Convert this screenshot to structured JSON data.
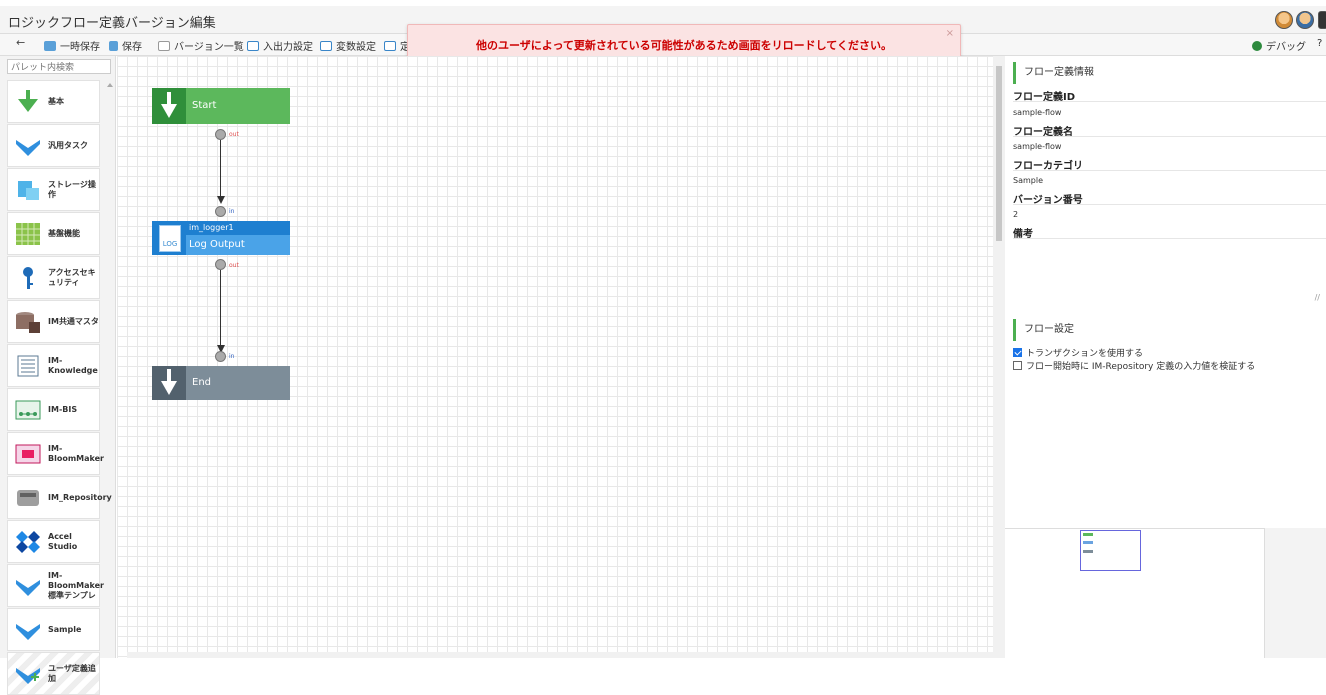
{
  "window": {
    "title": "ロジックフロー定義バージョン編集"
  },
  "toolbar": {
    "temp_save": "一時保存",
    "save": "保存",
    "version_list": "バージョン一覧",
    "io_settings": "入出力設定",
    "var_settings": "変数設定",
    "truncated": "定",
    "debug": "デバッグ",
    "help": "?"
  },
  "alert": {
    "message": "他のユーザによって更新されている可能性があるため画面をリロードしてください。",
    "close": "×"
  },
  "palette": {
    "search_placeholder": "パレット内検索",
    "items": [
      {
        "label": "基本",
        "icon": "green-down-arrow-icon"
      },
      {
        "label": "汎用タスク",
        "icon": "blue-down-arrow-icon"
      },
      {
        "label": "ストレージ操作",
        "icon": "storage-icon"
      },
      {
        "label": "基盤機能",
        "icon": "grid-icon"
      },
      {
        "label": "アクセスセキュリティ",
        "icon": "key-icon"
      },
      {
        "label": "IM共通マスタ",
        "icon": "database-icon"
      },
      {
        "label": "IM-Knowledge",
        "icon": "knowledge-icon"
      },
      {
        "label": "IM-BIS",
        "icon": "bis-icon"
      },
      {
        "label": "IM-BloomMaker",
        "icon": "bloommaker-icon"
      },
      {
        "label": "IM_Repository",
        "icon": "repository-icon"
      },
      {
        "label": "Accel Studio",
        "icon": "accel-studio-icon"
      },
      {
        "label": "IM-BloomMaker 標準テンプレ",
        "icon": "blue-down-arrow-icon"
      },
      {
        "label": "Sample",
        "icon": "blue-down-arrow-icon"
      },
      {
        "label": "ユーザ定義追加",
        "icon": "add-user-defined-icon"
      }
    ]
  },
  "canvas": {
    "start_node": {
      "label": "Start",
      "out_port": "out"
    },
    "log_node": {
      "name": "im_logger1",
      "label": "Log Output",
      "icon_text": "LOG",
      "in_port": "in",
      "out_port": "out"
    },
    "end_node": {
      "label": "End",
      "in_port": "in"
    }
  },
  "properties": {
    "section_title": "フロー定義情報",
    "flow_id_label": "フロー定義ID",
    "flow_id": "sample-flow",
    "flow_name_label": "フロー定義名",
    "flow_name": "sample-flow",
    "category_label": "フローカテゴリ",
    "category": "Sample",
    "version_label": "バージョン番号",
    "version": "2",
    "notes_label": "備考",
    "notes": ""
  },
  "flow_settings": {
    "section_title": "フロー設定",
    "use_transaction": "トランザクションを使用する",
    "use_transaction_checked": true,
    "validate_input": "フロー開始時に IM-Repository 定義の入力値を検証する",
    "validate_input_checked": false
  },
  "colors": {
    "start": "#5cb85c",
    "task": "#4aa3e8",
    "end": "#7d8d99",
    "alert_text": "#cc0000",
    "accent": "#4caf50"
  }
}
